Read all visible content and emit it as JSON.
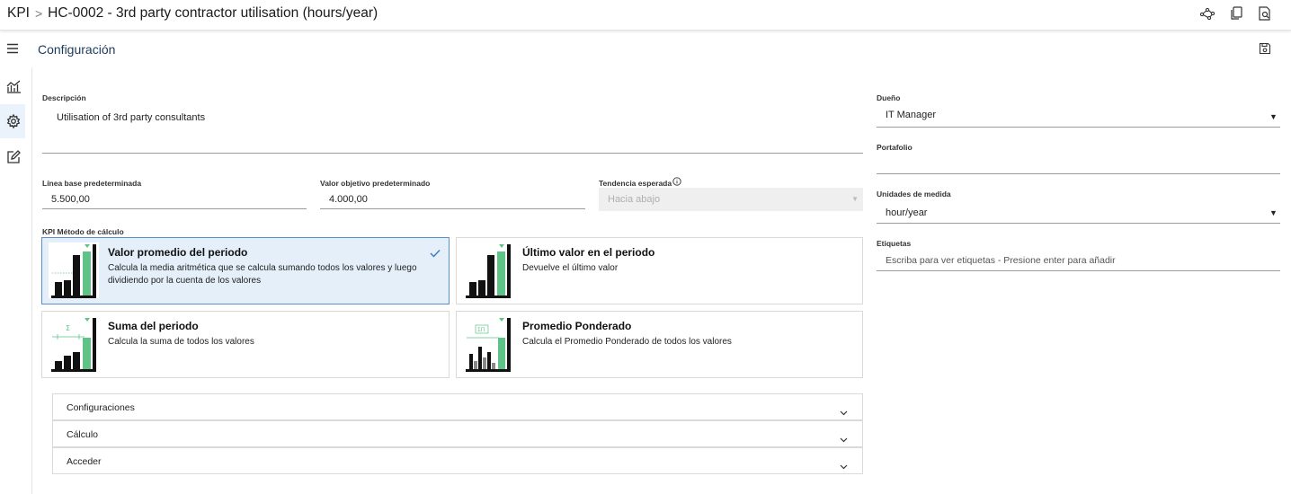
{
  "breadcrumb": {
    "root": "KPI",
    "separator": ">",
    "title": "HC-0002 - 3rd party contractor utilisation (hours/year)"
  },
  "top_icons": [
    "network-icon",
    "copy-icon",
    "search-document-icon"
  ],
  "sidebar": {
    "items": [
      {
        "icon": "menu-icon"
      },
      {
        "icon": "chart-icon"
      },
      {
        "icon": "gear-icon",
        "active": true
      },
      {
        "icon": "edit-icon"
      }
    ]
  },
  "section": {
    "title": "Configuración",
    "save_icon": "save-icon"
  },
  "form": {
    "descripcion_label": "Descripción",
    "descripcion_value": "Utilisation of 3rd party consultants",
    "linea_base_label": "Línea base predeterminada",
    "linea_base_value": "5.500,00",
    "valor_objetivo_label": "Valor objetivo predeterminado",
    "valor_objetivo_value": "4.000,00",
    "tendencia_label": "Tendencia esperada",
    "tendencia_value": "Hacia abajo",
    "metodo_label": "KPI Método de cálculo",
    "dueno_label": "Dueño",
    "dueno_value": "IT Manager",
    "portafolio_label": "Portafolio",
    "portafolio_value": "",
    "unidades_label": "Unidades de medida",
    "unidades_value": "hour/year",
    "etiquetas_label": "Etiquetas",
    "etiquetas_placeholder": "Escriba para ver etiquetas - Presione enter para añadir"
  },
  "methods": [
    {
      "title": "Valor promedio del periodo",
      "desc": "Calcula la media aritmética que se calcula sumando todos los valores y luego dividiendo por la cuenta de los valores",
      "selected": true
    },
    {
      "title": "Último valor en el periodo",
      "desc": "Devuelve el último valor",
      "selected": false
    },
    {
      "title": "Suma del periodo",
      "desc": "Calcula la suma de todos los valores",
      "selected": false
    },
    {
      "title": "Promedio Ponderado",
      "desc": "Calcula el Promedio Ponderado de todos los valores",
      "selected": false
    }
  ],
  "accordions": [
    {
      "label": "Configuraciones"
    },
    {
      "label": "Cálculo"
    },
    {
      "label": "Acceder"
    }
  ],
  "colors": {
    "accent": "#5b8fc7",
    "selected_bg": "#e4effa",
    "bar_green": "#5fc388",
    "bar_black": "#111111"
  }
}
